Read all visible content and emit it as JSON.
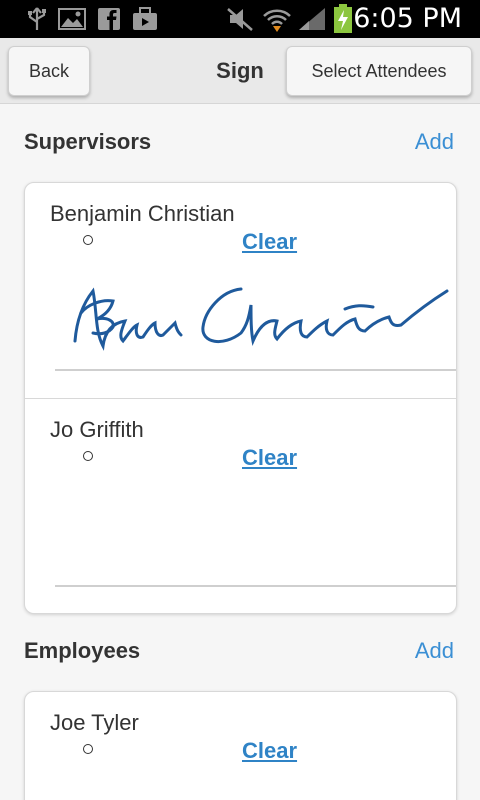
{
  "status_bar": {
    "time": "6:05 PM",
    "icons": [
      "usb-icon",
      "image-icon",
      "facebook-icon",
      "briefcase-icon",
      "mute-icon",
      "wifi-icon",
      "signal-icon",
      "battery-charging-icon"
    ]
  },
  "header": {
    "back_label": "Back",
    "title": "Sign",
    "attendees_label": "Select Attendees"
  },
  "supervisors": {
    "title": "Supervisors",
    "add_label": "Add",
    "entries": [
      {
        "name": "Benjamin Christian",
        "clear_label": "Clear"
      },
      {
        "name": "Jo Griffith",
        "clear_label": "Clear"
      }
    ]
  },
  "employees": {
    "title": "Employees",
    "add_label": "Add",
    "entries": [
      {
        "name": "Joe Tyler",
        "clear_label": "Clear"
      }
    ]
  },
  "colors": {
    "accent": "#3b8fd4",
    "signature_ink": "#1f5a9c"
  }
}
